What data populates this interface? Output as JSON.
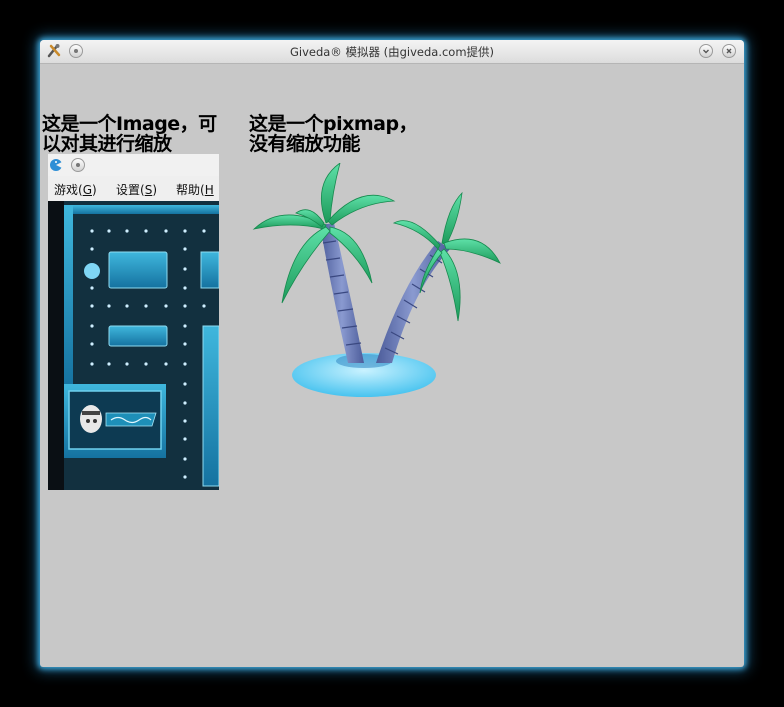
{
  "window": {
    "title": "Giveda® 模拟器 (由giveda.com提供)",
    "accent_glow": "#3fa7d9",
    "background": "#c8c8c8"
  },
  "icons": {
    "app": "tools-icon",
    "menu": "window-menu-icon",
    "minimize": "minimize-icon",
    "close": "close-icon"
  },
  "labels": {
    "image_line1": "这是一个Image，可",
    "image_line2": "以对其进行缩放",
    "pixmap_line1": "这是一个pixmap，",
    "pixmap_line2": "没有缩放功能"
  },
  "scaled_image": {
    "menu": [
      {
        "text": "游戏(",
        "accel": "G",
        "close": ")"
      },
      {
        "text": "设置(",
        "accel": "S",
        "close": ")"
      },
      {
        "text": "帮助(",
        "accel": "H",
        "close": ""
      }
    ]
  }
}
